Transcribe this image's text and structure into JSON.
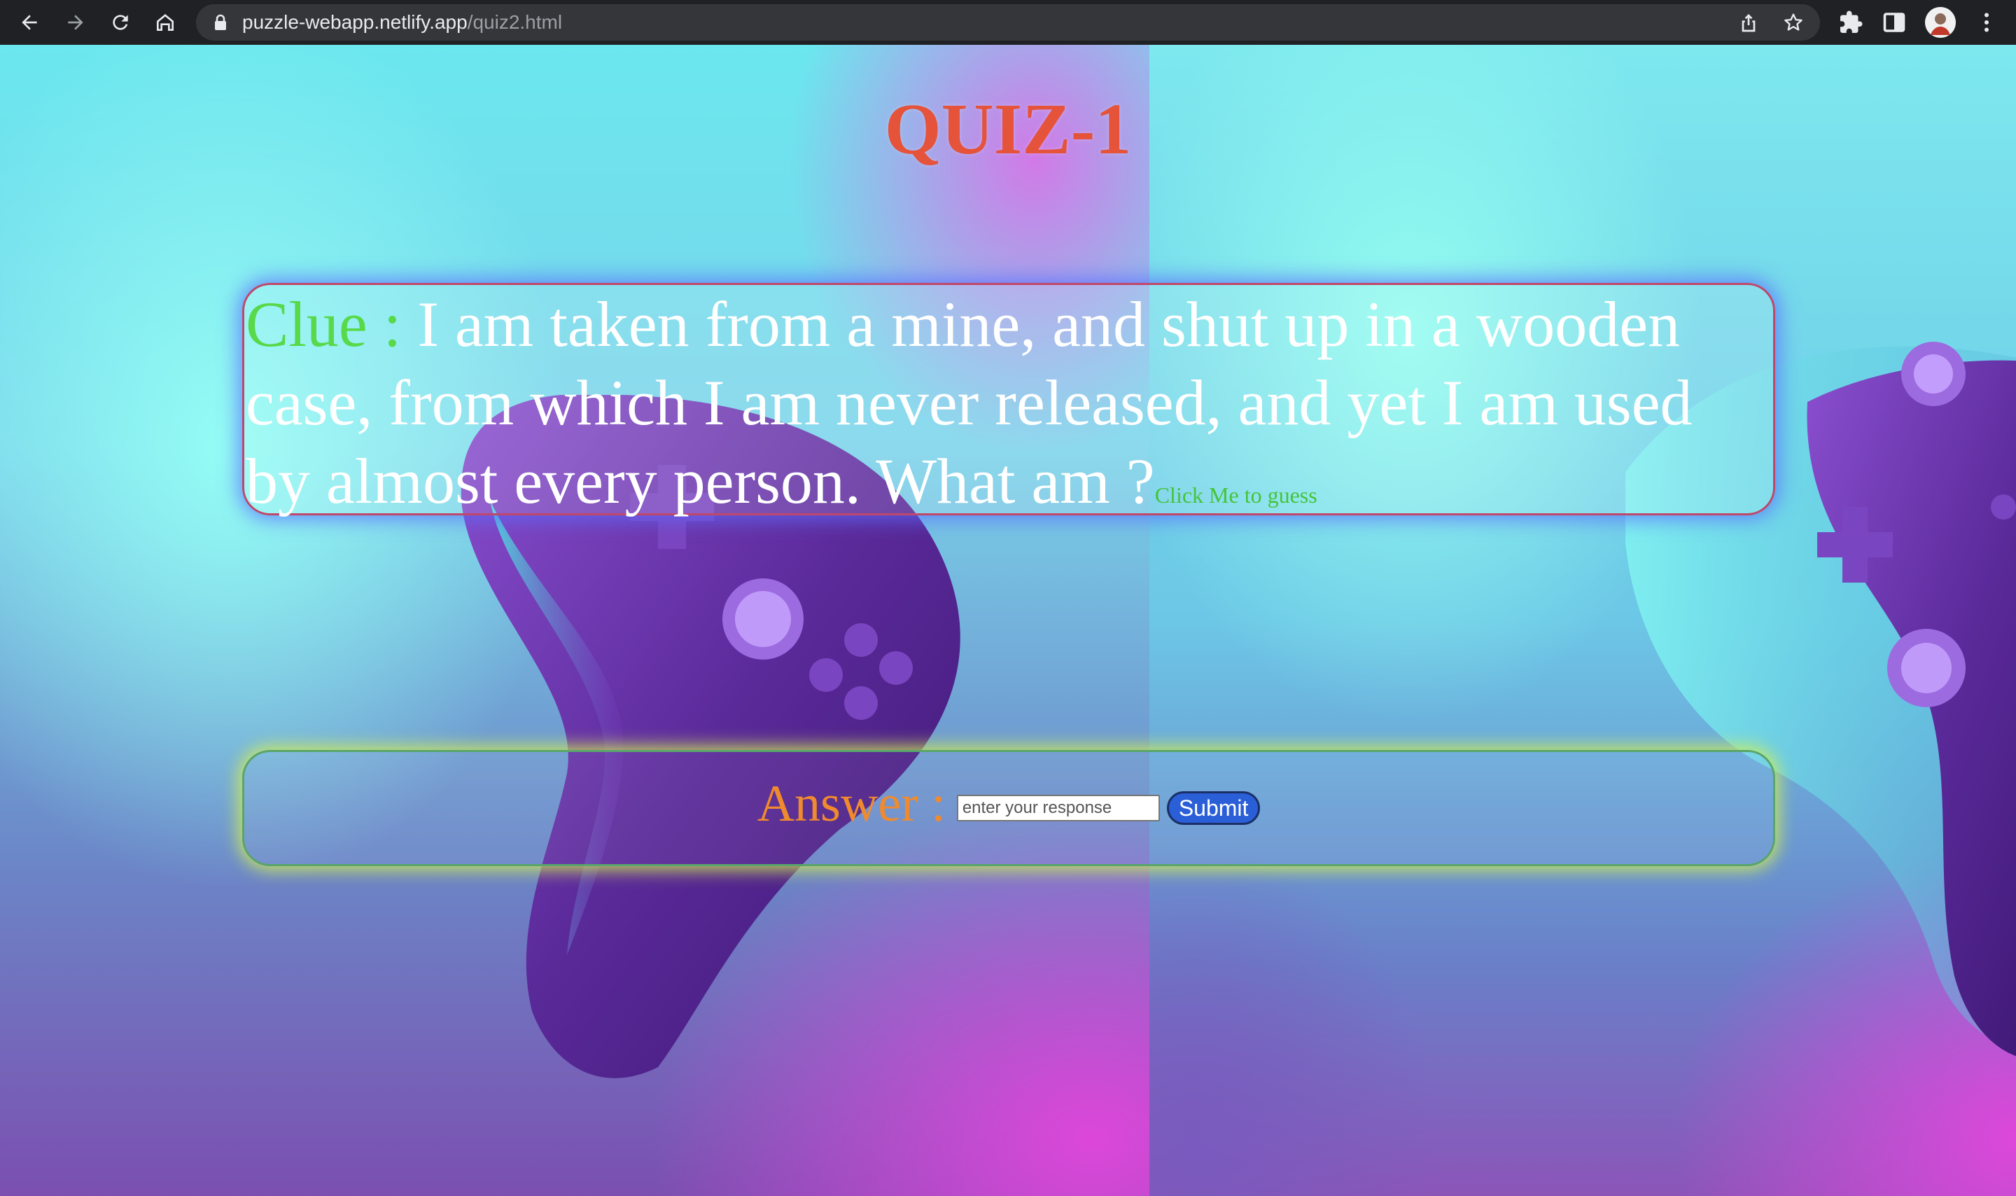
{
  "browser": {
    "url_host": "puzzle-webapp.netlify.app",
    "url_path": "/quiz2.html"
  },
  "quiz": {
    "title": "QUIZ-1",
    "clue_label": "Clue : ",
    "clue_text": "I am taken from a mine, and shut up in a wooden case, from which I am never released, and yet I am used by almost every person. What am ?",
    "clue_link": "Click Me to guess",
    "answer_label": "Answer : ",
    "answer_placeholder": "enter your response",
    "answer_value": "",
    "submit_label": "Submit"
  },
  "colors": {
    "title": "#e4533a",
    "clue_label": "#57d94a",
    "answer_label": "#f08a2e",
    "submit_bg": "#2a5fd8"
  },
  "icons": [
    "back-icon",
    "forward-icon",
    "reload-icon",
    "home-icon",
    "lock-icon",
    "share-icon",
    "bookmark-star-icon",
    "extensions-icon",
    "side-panel-icon",
    "profile-avatar",
    "more-menu-icon"
  ]
}
